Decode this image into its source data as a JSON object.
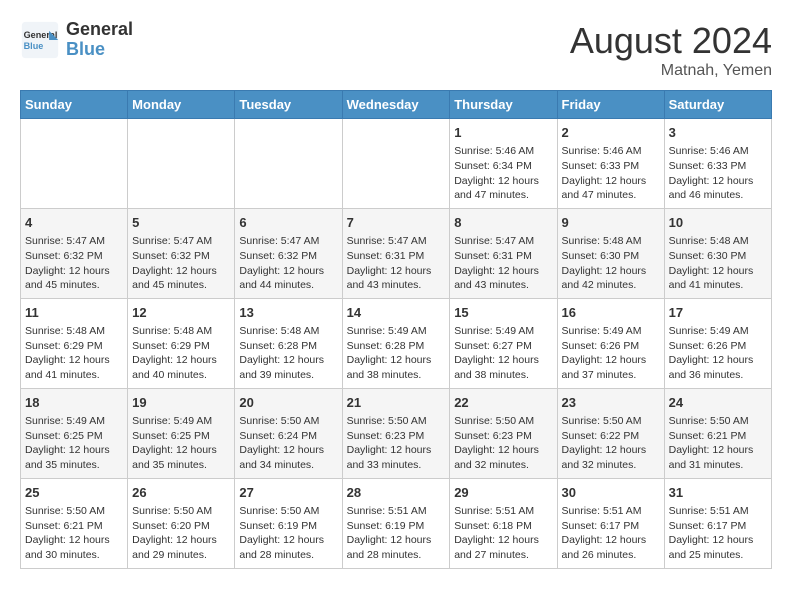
{
  "header": {
    "logo_line1": "General",
    "logo_line2": "Blue",
    "title": "August 2024",
    "subtitle": "Matnah, Yemen"
  },
  "days_of_week": [
    "Sunday",
    "Monday",
    "Tuesday",
    "Wednesday",
    "Thursday",
    "Friday",
    "Saturday"
  ],
  "weeks": [
    [
      {
        "day": "",
        "info": ""
      },
      {
        "day": "",
        "info": ""
      },
      {
        "day": "",
        "info": ""
      },
      {
        "day": "",
        "info": ""
      },
      {
        "day": "1",
        "info": "Sunrise: 5:46 AM\nSunset: 6:34 PM\nDaylight: 12 hours\nand 47 minutes."
      },
      {
        "day": "2",
        "info": "Sunrise: 5:46 AM\nSunset: 6:33 PM\nDaylight: 12 hours\nand 47 minutes."
      },
      {
        "day": "3",
        "info": "Sunrise: 5:46 AM\nSunset: 6:33 PM\nDaylight: 12 hours\nand 46 minutes."
      }
    ],
    [
      {
        "day": "4",
        "info": "Sunrise: 5:47 AM\nSunset: 6:32 PM\nDaylight: 12 hours\nand 45 minutes."
      },
      {
        "day": "5",
        "info": "Sunrise: 5:47 AM\nSunset: 6:32 PM\nDaylight: 12 hours\nand 45 minutes."
      },
      {
        "day": "6",
        "info": "Sunrise: 5:47 AM\nSunset: 6:32 PM\nDaylight: 12 hours\nand 44 minutes."
      },
      {
        "day": "7",
        "info": "Sunrise: 5:47 AM\nSunset: 6:31 PM\nDaylight: 12 hours\nand 43 minutes."
      },
      {
        "day": "8",
        "info": "Sunrise: 5:47 AM\nSunset: 6:31 PM\nDaylight: 12 hours\nand 43 minutes."
      },
      {
        "day": "9",
        "info": "Sunrise: 5:48 AM\nSunset: 6:30 PM\nDaylight: 12 hours\nand 42 minutes."
      },
      {
        "day": "10",
        "info": "Sunrise: 5:48 AM\nSunset: 6:30 PM\nDaylight: 12 hours\nand 41 minutes."
      }
    ],
    [
      {
        "day": "11",
        "info": "Sunrise: 5:48 AM\nSunset: 6:29 PM\nDaylight: 12 hours\nand 41 minutes."
      },
      {
        "day": "12",
        "info": "Sunrise: 5:48 AM\nSunset: 6:29 PM\nDaylight: 12 hours\nand 40 minutes."
      },
      {
        "day": "13",
        "info": "Sunrise: 5:48 AM\nSunset: 6:28 PM\nDaylight: 12 hours\nand 39 minutes."
      },
      {
        "day": "14",
        "info": "Sunrise: 5:49 AM\nSunset: 6:28 PM\nDaylight: 12 hours\nand 38 minutes."
      },
      {
        "day": "15",
        "info": "Sunrise: 5:49 AM\nSunset: 6:27 PM\nDaylight: 12 hours\nand 38 minutes."
      },
      {
        "day": "16",
        "info": "Sunrise: 5:49 AM\nSunset: 6:26 PM\nDaylight: 12 hours\nand 37 minutes."
      },
      {
        "day": "17",
        "info": "Sunrise: 5:49 AM\nSunset: 6:26 PM\nDaylight: 12 hours\nand 36 minutes."
      }
    ],
    [
      {
        "day": "18",
        "info": "Sunrise: 5:49 AM\nSunset: 6:25 PM\nDaylight: 12 hours\nand 35 minutes."
      },
      {
        "day": "19",
        "info": "Sunrise: 5:49 AM\nSunset: 6:25 PM\nDaylight: 12 hours\nand 35 minutes."
      },
      {
        "day": "20",
        "info": "Sunrise: 5:50 AM\nSunset: 6:24 PM\nDaylight: 12 hours\nand 34 minutes."
      },
      {
        "day": "21",
        "info": "Sunrise: 5:50 AM\nSunset: 6:23 PM\nDaylight: 12 hours\nand 33 minutes."
      },
      {
        "day": "22",
        "info": "Sunrise: 5:50 AM\nSunset: 6:23 PM\nDaylight: 12 hours\nand 32 minutes."
      },
      {
        "day": "23",
        "info": "Sunrise: 5:50 AM\nSunset: 6:22 PM\nDaylight: 12 hours\nand 32 minutes."
      },
      {
        "day": "24",
        "info": "Sunrise: 5:50 AM\nSunset: 6:21 PM\nDaylight: 12 hours\nand 31 minutes."
      }
    ],
    [
      {
        "day": "25",
        "info": "Sunrise: 5:50 AM\nSunset: 6:21 PM\nDaylight: 12 hours\nand 30 minutes."
      },
      {
        "day": "26",
        "info": "Sunrise: 5:50 AM\nSunset: 6:20 PM\nDaylight: 12 hours\nand 29 minutes."
      },
      {
        "day": "27",
        "info": "Sunrise: 5:50 AM\nSunset: 6:19 PM\nDaylight: 12 hours\nand 28 minutes."
      },
      {
        "day": "28",
        "info": "Sunrise: 5:51 AM\nSunset: 6:19 PM\nDaylight: 12 hours\nand 28 minutes."
      },
      {
        "day": "29",
        "info": "Sunrise: 5:51 AM\nSunset: 6:18 PM\nDaylight: 12 hours\nand 27 minutes."
      },
      {
        "day": "30",
        "info": "Sunrise: 5:51 AM\nSunset: 6:17 PM\nDaylight: 12 hours\nand 26 minutes."
      },
      {
        "day": "31",
        "info": "Sunrise: 5:51 AM\nSunset: 6:17 PM\nDaylight: 12 hours\nand 25 minutes."
      }
    ]
  ]
}
